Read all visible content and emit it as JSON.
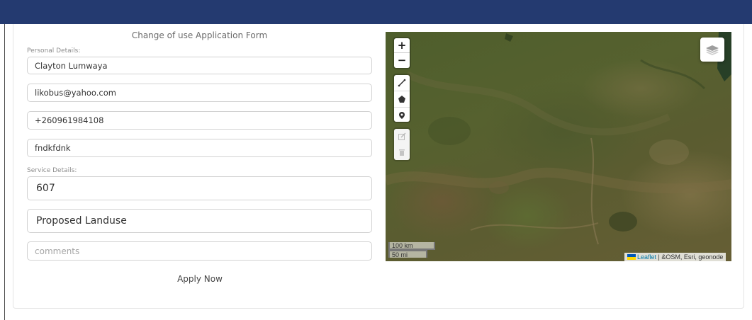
{
  "form": {
    "title": "Change of use Application Form",
    "personal_label": "Personal Details:",
    "name_value": "Clayton Lumwaya",
    "email_value": "likobus@yahoo.com",
    "phone_value": "+260961984108",
    "address_value": "fndkfdnk",
    "service_label": "Service Details:",
    "current_use_value": "607",
    "proposed_landuse_value": "Proposed Landuse",
    "comments_placeholder": "comments",
    "apply_label": "Apply Now"
  },
  "map": {
    "zoom_in": "+",
    "zoom_out": "−",
    "scale_km": "100 km",
    "scale_mi": "50 mi",
    "attribution_link": "Leaflet",
    "attribution_sep": " | ",
    "attribution_rest": "&OSM, Esri, geonode",
    "icons": [
      "polyline-icon",
      "polygon-icon",
      "marker-icon",
      "edit-layers-icon",
      "delete-layers-icon",
      "layers-icon"
    ]
  },
  "colors": {
    "header": "#243a70",
    "link": "#0078a8"
  }
}
